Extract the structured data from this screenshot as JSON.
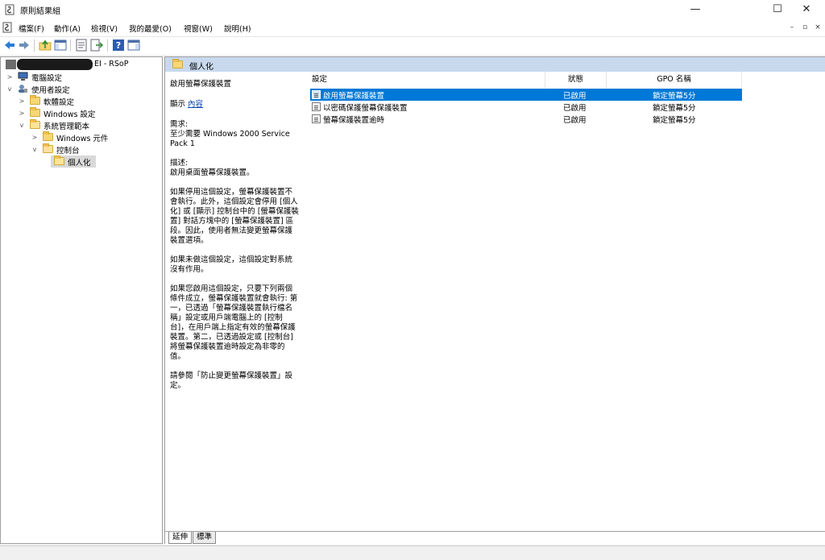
{
  "window": {
    "title": "原則結果組",
    "minimize": "—",
    "maximize": "☐",
    "close": "✕"
  },
  "menu": {
    "items": [
      "檔案(F)",
      "動作(A)",
      "檢視(V)",
      "我的最愛(O)",
      "視窗(W)",
      "說明(H)"
    ],
    "mdi_minimize": "–",
    "mdi_restore": "▫",
    "mdi_close": "×"
  },
  "toolbar": {
    "icons": [
      "back-arrow-icon",
      "forward-arrow-icon",
      "up-folder-icon",
      "show-hide-tree-icon",
      "properties-icon",
      "export-list-icon",
      "help-icon",
      "show-hide-action-pane-icon"
    ]
  },
  "tree": {
    "root_suffix": "EI - RSoP",
    "items": [
      {
        "label": "電腦設定",
        "arrow": ">"
      },
      {
        "label": "使用者設定",
        "arrow": "v"
      },
      {
        "label": "軟體設定",
        "arrow": ">"
      },
      {
        "label": "Windows 設定",
        "arrow": ">"
      },
      {
        "label": "系統管理範本",
        "arrow": "v"
      },
      {
        "label": "Windows 元件",
        "arrow": ">"
      },
      {
        "label": "控制台",
        "arrow": "v"
      },
      {
        "label": "個人化",
        "arrow": ""
      }
    ]
  },
  "right_pane": {
    "header_title": "個人化"
  },
  "description": {
    "title": "啟用螢幕保護裝置",
    "show_label": "顯示",
    "show_link": "內容",
    "lines": [
      "需求:",
      "至少需要 Windows 2000 Service",
      "Pack 1",
      "",
      "描述:",
      "啟用桌面螢幕保護裝置。",
      "",
      "如果停用這個設定，螢幕保護裝置不",
      "會執行。此外，這個設定會停用 [個人",
      "化] 或 [顯示] 控制台中的 [螢幕保護裝",
      "置] 對話方塊中的 [螢幕保護裝置] 區",
      "段。因此，使用者無法變更螢幕保護",
      "裝置選項。",
      "",
      "如果未做這個設定，這個設定對系統",
      "沒有作用。",
      "",
      "如果您啟用這個設定，只要下列兩個",
      "條件成立，螢幕保護裝置就會執行: 第",
      "一，已透過「螢幕保護裝置執行檔名",
      "稱」設定或用戶端電腦上的 [控制",
      "台]，在用戶端上指定有效的螢幕保護",
      "裝置。第二，已透過設定或 [控制台]",
      "將螢幕保護裝置逾時設定為非零的",
      "值。",
      "",
      "請參閱「防止變更螢幕保護裝置」設",
      "定。"
    ]
  },
  "list": {
    "columns": [
      "設定",
      "狀態",
      "GPO 名稱"
    ],
    "rows": [
      {
        "setting": "啟用螢幕保護裝置",
        "status": "已啟用",
        "gpo": "鎖定螢幕5分",
        "selected": true
      },
      {
        "setting": "以密碼保護螢幕保護裝置",
        "status": "已啟用",
        "gpo": "鎖定螢幕5分",
        "selected": false
      },
      {
        "setting": "螢幕保護裝置逾時",
        "status": "已啟用",
        "gpo": "鎖定螢幕5分",
        "selected": false
      }
    ]
  },
  "tabs": [
    "延伸",
    "標準"
  ],
  "colors": {
    "selection": "#0078d7",
    "header_band": "#c8d9ee",
    "folder": "#f7d775"
  }
}
